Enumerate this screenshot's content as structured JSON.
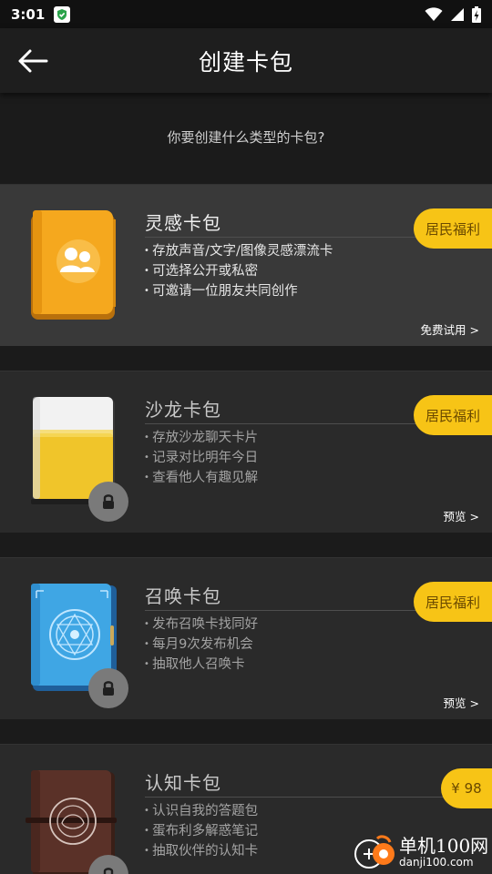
{
  "status_bar": {
    "time": "3:01",
    "icons": [
      "shield-app-icon",
      "wifi-icon",
      "signal-icon",
      "battery-charging-icon"
    ]
  },
  "header": {
    "title": "创建卡包",
    "back_icon": "arrow-left-icon"
  },
  "question": "你要创建什么类型的卡包?",
  "cards": [
    {
      "name": "灵感卡包",
      "features": [
        "存放声音/文字/图像灵感漂流卡",
        "可选择公开或私密",
        "可邀请一位朋友共同创作"
      ],
      "badge": "居民福利",
      "action": "免费试用 >",
      "locked": false,
      "icon": "orange-book-users-icon"
    },
    {
      "name": "沙龙卡包",
      "features": [
        "存放沙龙聊天卡片",
        "记录对比明年今日",
        "查看他人有趣见解"
      ],
      "badge": "居民福利",
      "action": "预览 >",
      "locked": true,
      "icon": "yellow-white-book-icon"
    },
    {
      "name": "召唤卡包",
      "features": [
        "发布召唤卡找同好",
        "每月9次发布机会",
        "抽取他人召唤卡"
      ],
      "badge": "居民福利",
      "action": "预览 >",
      "locked": true,
      "icon": "blue-magic-book-icon"
    },
    {
      "name": "认知卡包",
      "features": [
        "认识自我的答题包",
        "蛋布利多解惑笔记",
        "抽取伙伴的认知卡"
      ],
      "badge": "¥ 98",
      "action": "",
      "locked": true,
      "icon": "brown-leather-book-icon"
    }
  ],
  "watermark": {
    "name": "单机100网",
    "url": "danji100.com"
  },
  "colors": {
    "accent": "#f7c416",
    "background": "#1b1b1b",
    "card": "#2a2a2a",
    "card_active": "#393939"
  }
}
